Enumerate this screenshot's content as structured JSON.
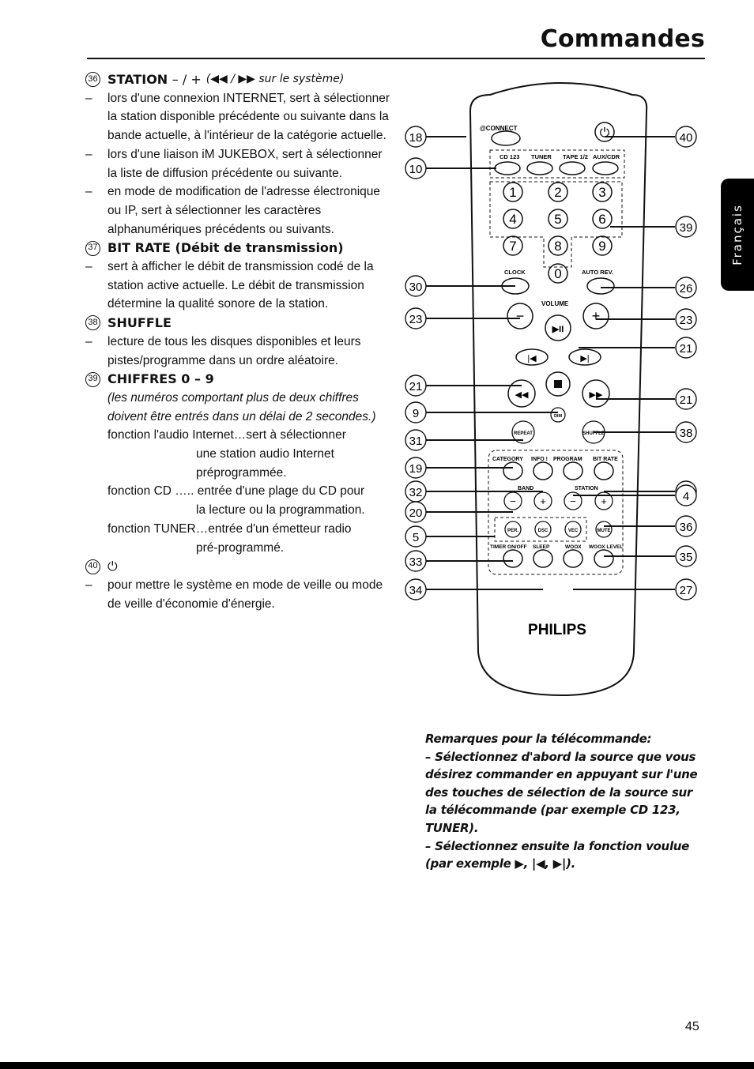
{
  "header": {
    "title": "Commandes"
  },
  "language_tab": "Français",
  "items": [
    {
      "number": "36",
      "title": "STATION",
      "title_suffix": "– / +",
      "title_note": "(◀◀ / ▶▶ sur le système)",
      "bullets": [
        "lors d'une connexion INTERNET, sert à sélectionner la station disponible précédente ou suivante dans la bande actuelle, à l'intérieur de la catégorie actuelle.",
        "lors d'une liaison iM JUKEBOX, sert à sélectionner la liste de diffusion précédente ou suivante.",
        "en mode de modification de l'adresse électronique ou IP, sert à sélectionner les caractères alphanumériques précédents ou suivants."
      ]
    },
    {
      "number": "37",
      "title": "BIT RATE (Débit de transmission)",
      "bullets": [
        "sert à afficher le débit de transmission codé de la station active actuelle. Le débit de transmission détermine la qualité sonore de la station."
      ]
    },
    {
      "number": "38",
      "title": "SHUFFLE",
      "bullets": [
        "lecture de tous les disques disponibles et leurs pistes/programme dans un ordre aléatoire."
      ]
    },
    {
      "number": "39",
      "title": "CHIFFRES 0 – 9",
      "note": "(les numéros comportant plus de deux chiffres doivent être entrés dans un délai de 2 secondes.)",
      "functions": [
        {
          "label": "fonction l'audio Internet…",
          "text": "sert à sélectionner",
          "cont": [
            "une station audio Internet",
            "préprogrammée."
          ]
        },
        {
          "label": "fonction CD …..",
          "text": "entrée d'une plage du CD pour",
          "cont": [
            "la lecture ou la programmation."
          ]
        },
        {
          "label": "fonction TUNER…",
          "text": "entrée d'un émetteur radio",
          "cont": [
            "pré-programmé."
          ]
        }
      ]
    },
    {
      "number": "40",
      "title": "⏻",
      "bullets": [
        "pour mettre le système en mode de veille ou mode de veille d'économie d'énergie."
      ]
    }
  ],
  "remote": {
    "brand": "PHILIPS",
    "labels": {
      "connect": "@CONNECT",
      "cd": "CD 123",
      "tuner": "TUNER",
      "tape": "TAPE 1/2",
      "aux": "AUX/CDR",
      "clock": "CLOCK",
      "auto_rev": "AUTO REV.",
      "volume": "VOLUME",
      "dim": "DIM",
      "repeat": "REPEAT",
      "shuffle": "SHUFFLE",
      "category": "CATEGORY",
      "info": "INFO !",
      "program": "PROGRAM",
      "bit_rate": "BIT RATE",
      "band": "BAND",
      "station": "STATION",
      "per": "PER.",
      "dsc": "DSC",
      "vec": "VEC",
      "mute": "MUTE",
      "timer": "TIMER ON/OFF",
      "sleep": "SLEEP",
      "woox": "WOOX",
      "woox_level": "WOOX LEVEL"
    },
    "digits": [
      "1",
      "2",
      "3",
      "4",
      "5",
      "6",
      "7",
      "8",
      "9",
      "0"
    ],
    "callouts_left": [
      "18",
      "10",
      "30",
      "23",
      "21",
      "9",
      "31",
      "19",
      "32",
      "20",
      "5",
      "33",
      "34"
    ],
    "callouts_right": [
      "40",
      "39",
      "26",
      "23",
      "21",
      "21",
      "38",
      "37",
      "4",
      "36",
      "35",
      "27"
    ]
  },
  "notes": {
    "heading": "Remarques pour la télécommande:",
    "lines": [
      "– Sélectionnez d'abord la source que vous désirez commander en appuyant sur l'une des touches de sélection de la source sur la télécommande (par exemple CD 123, TUNER).",
      "– Sélectionnez ensuite la fonction voulue (par exemple ▶, |◀, ▶|)."
    ]
  },
  "footer": {
    "page_number": "45"
  }
}
